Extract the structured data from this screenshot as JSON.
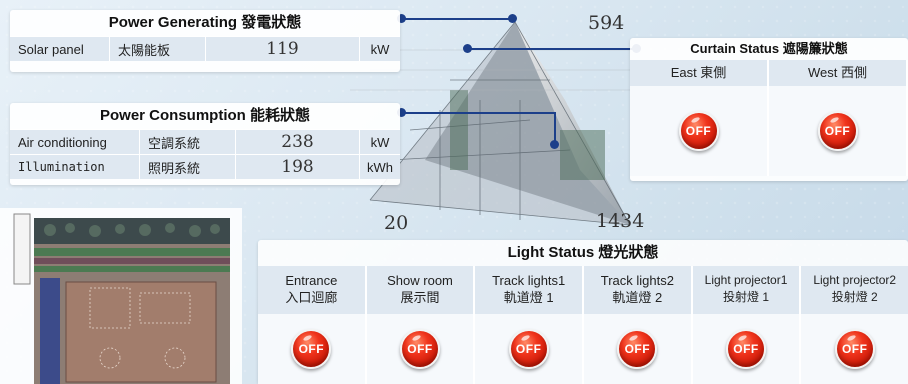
{
  "power_generating": {
    "title": "Power Generating 發電狀態",
    "rows": [
      {
        "name_en": "Solar panel",
        "name_zh": "太陽能板",
        "value": "119",
        "unit": "kW"
      }
    ]
  },
  "power_consumption": {
    "title": "Power Consumption 能耗狀態",
    "rows": [
      {
        "name_en": "Air conditioning",
        "name_zh": "空調系統",
        "value": "238",
        "unit": "kW"
      },
      {
        "name_en": "Illumination",
        "name_zh": "照明系統",
        "value": "198",
        "unit": "kWh"
      }
    ]
  },
  "dimensions": {
    "top": "594",
    "left": "20",
    "right": "1434"
  },
  "curtain": {
    "title": "Curtain Status 遮陽簾狀態",
    "items": [
      {
        "label": "East 東側",
        "state": "OFF"
      },
      {
        "label": "West 西側",
        "state": "OFF"
      }
    ]
  },
  "light": {
    "title": "Light Status 燈光狀態",
    "items": [
      {
        "en": "Entrance",
        "zh": "入口迴廊",
        "state": "OFF"
      },
      {
        "en": "Show room",
        "zh": "展示間",
        "state": "OFF"
      },
      {
        "en": "Track lights1",
        "zh": "軌道燈 1",
        "state": "OFF"
      },
      {
        "en": "Track lights2",
        "zh": "軌道燈 2",
        "state": "OFF"
      },
      {
        "en": "Light projector1",
        "zh": "投射燈 1",
        "state": "OFF"
      },
      {
        "en": "Light projector2",
        "zh": "投射燈 2",
        "state": "OFF"
      }
    ]
  },
  "colors": {
    "off_button": "#e0260f",
    "connector": "#1c3f8a",
    "row_bg": "#dfe8f1"
  }
}
